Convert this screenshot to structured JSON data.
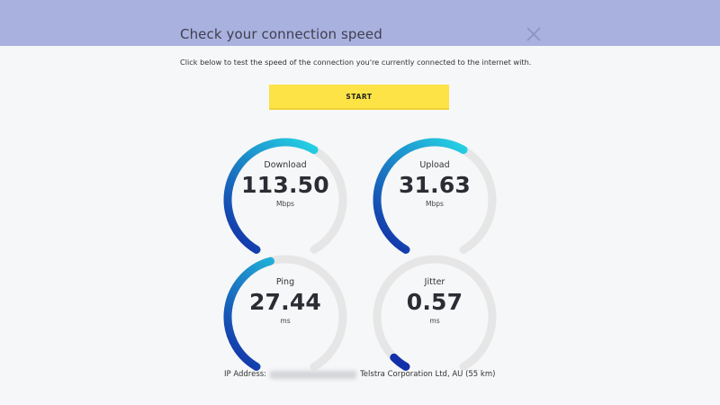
{
  "dialog": {
    "title": "Check your connection speed",
    "subtitle": "Click below to test the speed of the connection you're currently connected to the internet with.",
    "start_label": "START",
    "close_icon": "close-icon"
  },
  "colors": {
    "header": "#a9b1df",
    "start_button": "#fde345",
    "gauge_track": "#e6e6e6",
    "gauge_gradient_start": "#1230a8",
    "gauge_gradient_end": "#25d6e6"
  },
  "gauges": [
    {
      "label": "Download",
      "value": "113.50",
      "unit": "Mbps",
      "fill": 0.6
    },
    {
      "label": "Upload",
      "value": "31.63",
      "unit": "Mbps",
      "fill": 0.6
    },
    {
      "label": "Ping",
      "value": "27.44",
      "unit": "ms",
      "fill": 0.45
    },
    {
      "label": "Jitter",
      "value": "0.57",
      "unit": "ms",
      "fill": 0.05
    }
  ],
  "footer": {
    "ip_label": "IP Address:",
    "isp": "Telstra Corporation Ltd, AU (55 km)"
  }
}
